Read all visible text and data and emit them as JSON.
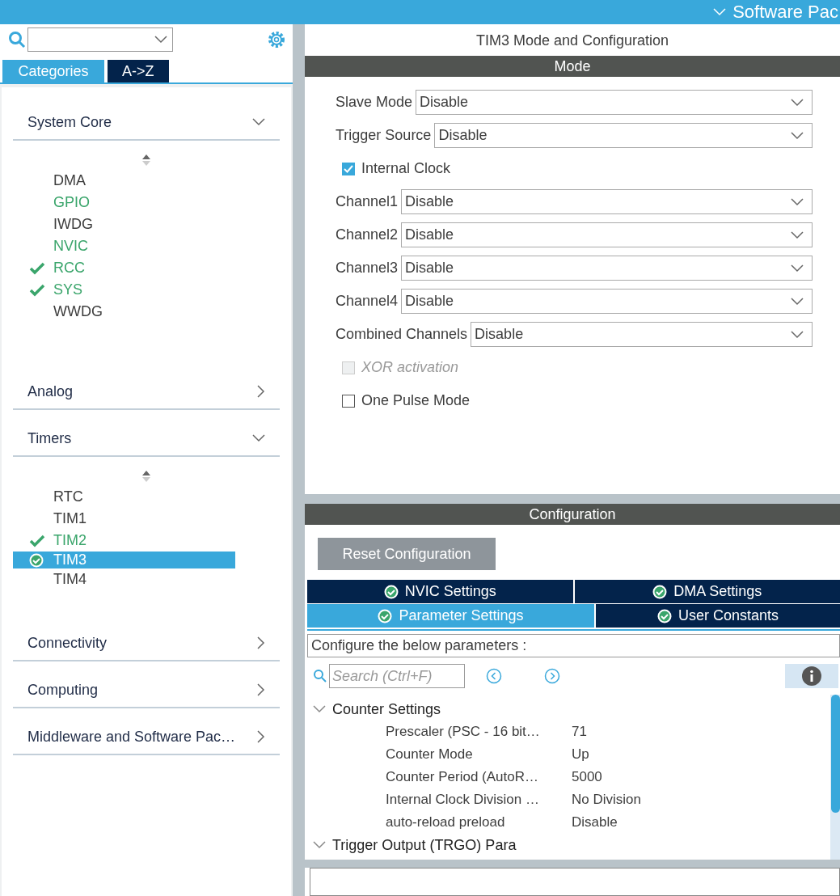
{
  "top_bar": {
    "title": "Software Pac"
  },
  "sidebar": {
    "tabs": [
      {
        "label": "Categories",
        "selected": true
      },
      {
        "label": "A->Z",
        "selected": false
      }
    ],
    "categories": [
      {
        "label": "System Core",
        "expanded": true,
        "items": [
          {
            "label": "DMA",
            "enabled": false,
            "configured": false,
            "selected": false
          },
          {
            "label": "GPIO",
            "enabled": true,
            "configured": false,
            "selected": false
          },
          {
            "label": "IWDG",
            "enabled": false,
            "configured": false,
            "selected": false
          },
          {
            "label": "NVIC",
            "enabled": true,
            "configured": false,
            "selected": false
          },
          {
            "label": "RCC",
            "enabled": true,
            "configured": true,
            "selected": false
          },
          {
            "label": "SYS",
            "enabled": true,
            "configured": true,
            "selected": false
          },
          {
            "label": "WWDG",
            "enabled": false,
            "configured": false,
            "selected": false
          }
        ]
      },
      {
        "label": "Analog",
        "expanded": false
      },
      {
        "label": "Timers",
        "expanded": true,
        "items": [
          {
            "label": "RTC",
            "enabled": false,
            "configured": false,
            "selected": false
          },
          {
            "label": "TIM1",
            "enabled": false,
            "configured": false,
            "selected": false
          },
          {
            "label": "TIM2",
            "enabled": true,
            "configured": true,
            "selected": false
          },
          {
            "label": "TIM3",
            "enabled": true,
            "configured": true,
            "selected": true
          },
          {
            "label": "TIM4",
            "enabled": false,
            "configured": false,
            "selected": false
          }
        ]
      },
      {
        "label": "Connectivity",
        "expanded": false
      },
      {
        "label": "Computing",
        "expanded": false
      },
      {
        "label": "Middleware and Software Pac…",
        "expanded": false
      }
    ]
  },
  "title": "TIM3 Mode and Configuration",
  "mode": {
    "header": "Mode",
    "fields": [
      {
        "kind": "select",
        "label": "Slave Mode",
        "value": "Disable"
      },
      {
        "kind": "select",
        "label": "Trigger Source",
        "value": "Disable"
      },
      {
        "kind": "checkbox",
        "label": "Internal Clock",
        "checked": true,
        "disabled": false
      },
      {
        "kind": "select",
        "label": "Channel1",
        "value": "Disable"
      },
      {
        "kind": "select",
        "label": "Channel2",
        "value": "Disable"
      },
      {
        "kind": "select",
        "label": "Channel3",
        "value": "Disable"
      },
      {
        "kind": "select",
        "label": "Channel4",
        "value": "Disable"
      },
      {
        "kind": "select",
        "label": "Combined Channels",
        "value": "Disable"
      },
      {
        "kind": "checkbox",
        "label": "XOR activation",
        "checked": false,
        "disabled": true
      },
      {
        "kind": "checkbox",
        "label": "One Pulse Mode",
        "checked": false,
        "disabled": false
      }
    ]
  },
  "configuration": {
    "header": "Configuration",
    "reset_button": "Reset Configuration",
    "tab_rows": [
      [
        {
          "label": "NVIC Settings",
          "selected": false
        },
        {
          "label": "DMA Settings",
          "selected": false
        }
      ],
      [
        {
          "label": "Parameter Settings",
          "selected": true
        },
        {
          "label": "User Constants",
          "selected": false
        }
      ]
    ],
    "hint": "Configure the below parameters :",
    "search": {
      "placeholder": "Search (Ctrl+F)"
    },
    "parameters": [
      {
        "label": "Counter Settings",
        "expanded": true,
        "children": [
          {
            "label": "Prescaler (PSC - 16 bit…",
            "value": "71"
          },
          {
            "label": "Counter Mode",
            "value": "Up"
          },
          {
            "label": "Counter Period (AutoR…",
            "value": "5000"
          },
          {
            "label": "Internal Clock Division …",
            "value": "No Division"
          },
          {
            "label": "auto-reload preload",
            "value": "Disable"
          }
        ]
      },
      {
        "label": "Trigger Output (TRGO) Para",
        "expanded": true
      }
    ]
  }
}
